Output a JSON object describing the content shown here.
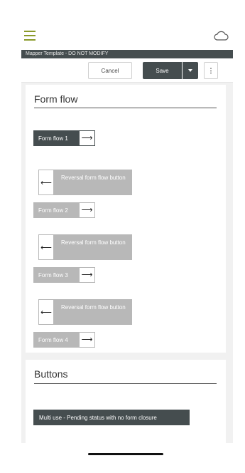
{
  "header": {
    "menu_icon": "hamburger-icon",
    "cloud_icon": "cloud-icon",
    "template_title": "Mapper Template - DO NOT MODIFY"
  },
  "toolbar": {
    "cancel_label": "Cancel",
    "save_label": "Save",
    "save_dropdown_icon": "caret-down-icon",
    "more_label": "⋮"
  },
  "colors": {
    "accent": "#8a9a2a",
    "dark": "#454d4f",
    "muted": "#b8b8b8"
  },
  "form_flow_section": {
    "title": "Form flow",
    "buttons": [
      {
        "label": "Form flow 1",
        "arrow": "⟶",
        "state": "active"
      },
      {
        "label": "Form flow 2",
        "arrow": "⟶",
        "state": "disabled"
      },
      {
        "label": "Form flow 3",
        "arrow": "⟶",
        "state": "disabled"
      },
      {
        "label": "Form flow 4",
        "arrow": "⟶",
        "state": "disabled"
      }
    ],
    "reversal_buttons": [
      {
        "label": "Reversal form flow button",
        "arrow": "⟵"
      },
      {
        "label": "Reversal form flow button",
        "arrow": "⟵"
      },
      {
        "label": "Reversal form flow button",
        "arrow": "⟵"
      }
    ]
  },
  "buttons_section": {
    "title": "Buttons",
    "multi_use_label": "Multi use - Pending status with no form closure"
  }
}
